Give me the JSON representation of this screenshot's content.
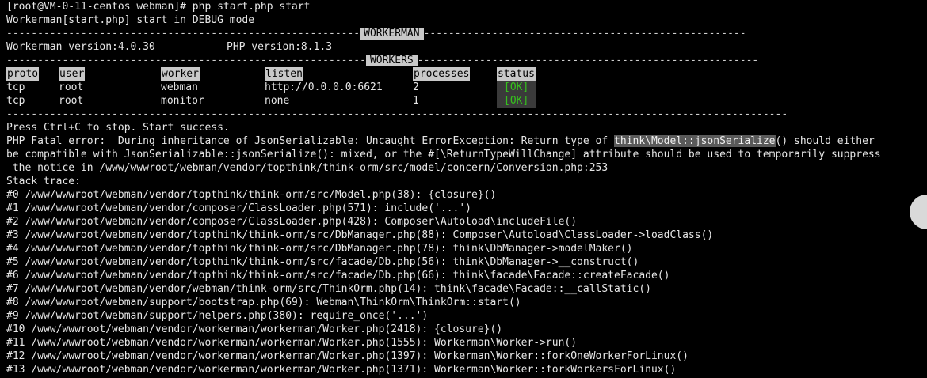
{
  "terminal": {
    "prompt_line": "[root@VM-0-11-centos webman]# php start.php start",
    "debug_line": "Workerman[start.php] start in DEBUG mode",
    "banner_workerman": "WORKERMAN",
    "workerman_version": "Workerman version:4.0.30",
    "php_version": "PHP version:8.1.3",
    "banner_workers": "WORKERS",
    "table": {
      "headers": [
        "proto",
        "user",
        "worker",
        "listen",
        "processes",
        "status"
      ],
      "rows": [
        [
          "tcp",
          "root",
          "webman",
          "http://0.0.0.0:6621",
          "2",
          "[OK]"
        ],
        [
          "tcp",
          "root",
          "monitor",
          "none",
          "1",
          "[OK]"
        ]
      ]
    },
    "ctrl_c_line": "Press Ctrl+C to stop. Start success.",
    "fatal_prefix": "PHP Fatal error:  During inheritance of JsonSerializable: Uncaught ErrorException: Return type of ",
    "fatal_highlight": "think\\Model::jsonSerialize",
    "fatal_suffix": "() should either",
    "fatal_line2": "be compatible with JsonSerializable::jsonSerialize(): mixed, or the #[\\ReturnTypeWillChange] attribute should be used to temporarily suppress",
    "fatal_line3": " the notice in /www/wwwroot/webman/vendor/topthink/think-orm/src/model/concern/Conversion.php:253",
    "stack_trace_label": "Stack trace:",
    "stack": [
      "#0 /www/wwwroot/webman/vendor/topthink/think-orm/src/Model.php(38): {closure}()",
      "#1 /www/wwwroot/webman/vendor/composer/ClassLoader.php(571): include('...')",
      "#2 /www/wwwroot/webman/vendor/composer/ClassLoader.php(428): Composer\\Autoload\\includeFile()",
      "#3 /www/wwwroot/webman/vendor/topthink/think-orm/src/DbManager.php(88): Composer\\Autoload\\ClassLoader->loadClass()",
      "#4 /www/wwwroot/webman/vendor/topthink/think-orm/src/DbManager.php(78): think\\DbManager->modelMaker()",
      "#5 /www/wwwroot/webman/vendor/topthink/think-orm/src/facade/Db.php(56): think\\DbManager->__construct()",
      "#6 /www/wwwroot/webman/vendor/topthink/think-orm/src/facade/Db.php(66): think\\facade\\Facade::createFacade()",
      "#7 /www/wwwroot/webman/vendor/webman/think-orm/src/ThinkOrm.php(14): think\\facade\\Facade::__callStatic()",
      "#8 /www/wwwroot/webman/support/bootstrap.php(69): Webman\\ThinkOrm\\ThinkOrm::start()",
      "#9 /www/wwwroot/webman/support/helpers.php(380): require_once('...')",
      "#10 /www/wwwroot/webman/vendor/workerman/workerman/Worker.php(2418): {closure}()",
      "#11 /www/wwwroot/webman/vendor/workerman/workerman/Worker.php(1555): Workerman\\Worker->run()",
      "#12 /www/wwwroot/webman/vendor/workerman/workerman/Worker.php(1397): Workerman\\Worker::forkOneWorkerForLinux()",
      "#13 /www/wwwroot/webman/vendor/workerman/workerman/Worker.php(1371): Workerman\\Worker::forkWorkersForLinux()"
    ],
    "colors": {
      "background": "#000000",
      "text": "#e6e6e6",
      "ok_green": "#35c21c",
      "header_bg": "#c8c8c8",
      "highlight_bg": "#5a5a5a"
    }
  }
}
